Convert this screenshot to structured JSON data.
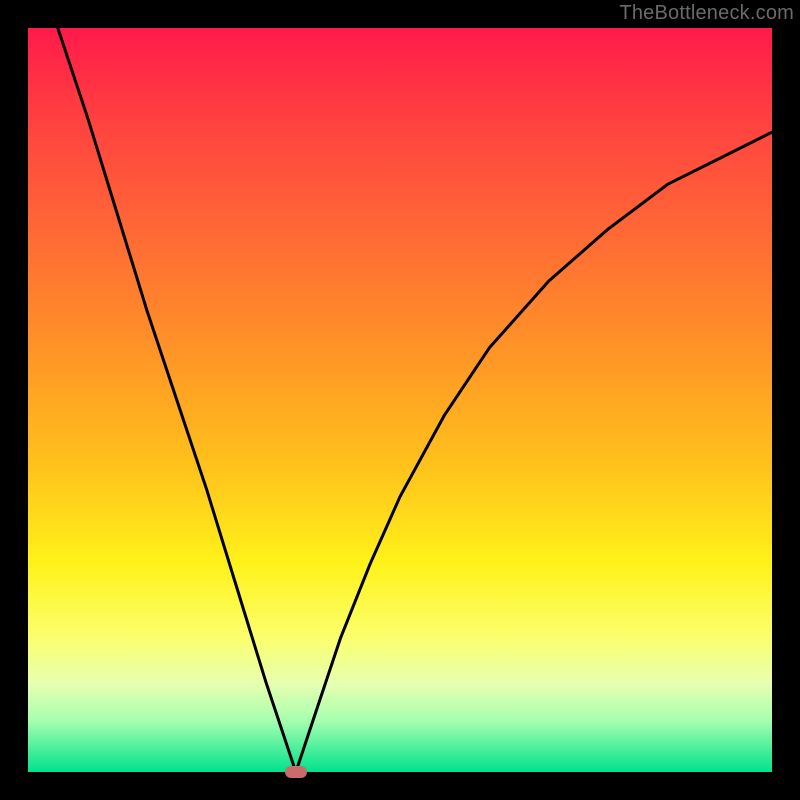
{
  "watermark": "TheBottleneck.com",
  "chart_data": {
    "type": "line",
    "title": "",
    "xlabel": "",
    "ylabel": "",
    "xlim": [
      0,
      100
    ],
    "ylim": [
      0,
      100
    ],
    "min_point": {
      "x": 36,
      "y": 0
    },
    "left_branch": {
      "x": [
        4,
        8,
        12,
        16,
        20,
        24,
        28,
        32,
        34,
        35,
        36
      ],
      "y": [
        100,
        88,
        75,
        62,
        50,
        38,
        25,
        12,
        6,
        3,
        0
      ]
    },
    "right_branch": {
      "x": [
        36,
        37,
        38,
        40,
        42,
        46,
        50,
        56,
        62,
        70,
        78,
        86,
        94,
        100
      ],
      "y": [
        0,
        3,
        6,
        12,
        18,
        28,
        37,
        48,
        57,
        66,
        73,
        79,
        83,
        86
      ]
    },
    "gradient_stops": [
      {
        "pos": 0,
        "color": "#ff1a4b"
      },
      {
        "pos": 12,
        "color": "#ff4040"
      },
      {
        "pos": 28,
        "color": "#ff6a35"
      },
      {
        "pos": 42,
        "color": "#ff9028"
      },
      {
        "pos": 58,
        "color": "#ffbf1c"
      },
      {
        "pos": 72,
        "color": "#fff21a"
      },
      {
        "pos": 82,
        "color": "#fbff6e"
      },
      {
        "pos": 88,
        "color": "#e8ffb0"
      },
      {
        "pos": 93,
        "color": "#a8ffb0"
      },
      {
        "pos": 100,
        "color": "#00e28b"
      }
    ]
  }
}
